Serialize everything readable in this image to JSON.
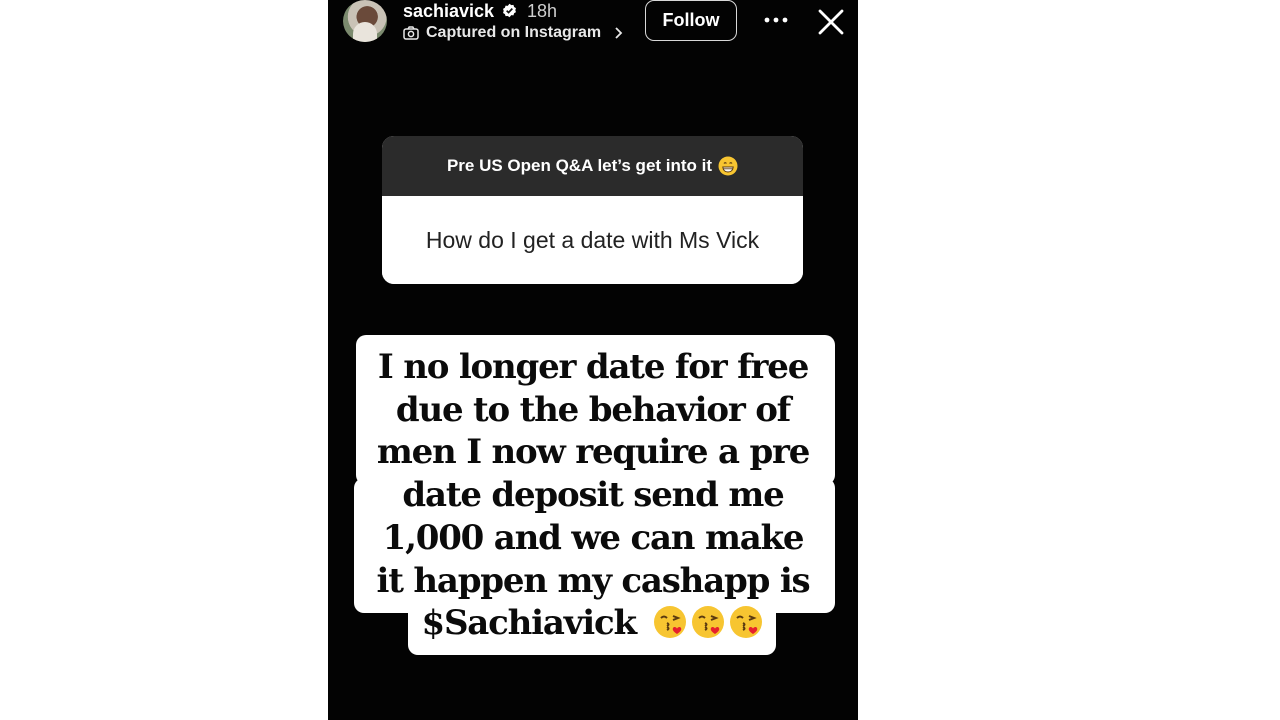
{
  "story": {
    "username": "sachiavick",
    "time": "18h",
    "captured_label": "Captured on Instagram",
    "follow_label": "Follow",
    "icons": {
      "verified": "verified-badge-icon",
      "camera": "camera-icon",
      "chevron": "chevron-right-icon",
      "more": "more-options-icon",
      "close": "close-icon"
    }
  },
  "question_box": {
    "prompt": "Pre US Open Q&A let’s get into it",
    "prompt_emoji": "grinning-face-emoji",
    "question": "How do I get a date with Ms Vick"
  },
  "answer": {
    "lines": [
      "I no longer date for free",
      "due to the behavior of",
      "men I now require a pre",
      "date deposit send me",
      "1,000 and we can make",
      "it happen my cashapp is",
      "$Sachiavick"
    ],
    "emojis": [
      "face-blowing-kiss-emoji",
      "face-blowing-kiss-emoji",
      "face-blowing-kiss-emoji"
    ]
  }
}
